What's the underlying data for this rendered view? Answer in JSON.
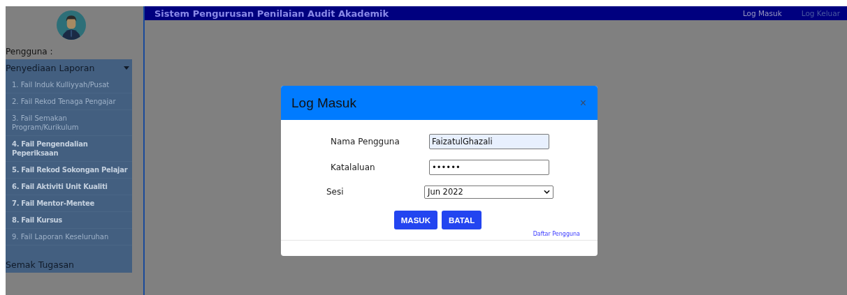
{
  "header": {
    "title": "Sistem Pengurusan Penilaian Audit Akademik",
    "nav": [
      {
        "label": "Log Masuk",
        "disabled": false
      },
      {
        "label": "Log Keluar",
        "disabled": true
      }
    ]
  },
  "sidebar": {
    "user_label": "Pengguna :",
    "menu": {
      "label": "Penyediaan Laporan",
      "expanded": true,
      "items": [
        {
          "label": "1. Fail Induk Kulliyyah/Pusat",
          "disabled": true
        },
        {
          "label": "2. Fail Rekod Tenaga Pengajar",
          "disabled": true
        },
        {
          "label": "3. Fail Semakan Program/Kurikulum",
          "disabled": true
        },
        {
          "label": "4. Fail Pengendalian Peperiksaan",
          "disabled": false
        },
        {
          "label": "5. Fail Rekod Sokongan Pelajar",
          "disabled": false
        },
        {
          "label": "6. Fail Aktiviti Unit Kualiti",
          "disabled": false
        },
        {
          "label": "7. Fail Mentor-Mentee",
          "disabled": false
        },
        {
          "label": "8. Fail Kursus",
          "disabled": false
        },
        {
          "label": "9. Fail Laporan Keseluruhan",
          "disabled": true
        }
      ]
    },
    "extra": "Semak Tugasan"
  },
  "dialog": {
    "title": "Log Masuk",
    "close": "×",
    "fields": [
      {
        "label": "Nama Pengguna",
        "kind": "text",
        "value": "FaizatulGhazali"
      },
      {
        "label": "Katalaluan",
        "kind": "password",
        "value": "••••••"
      },
      {
        "label": "Sesi",
        "kind": "select",
        "value": "Jun 2022"
      }
    ],
    "buttons": [
      "MASUK",
      "BATAL"
    ],
    "link": "Daftar Pengguna"
  }
}
